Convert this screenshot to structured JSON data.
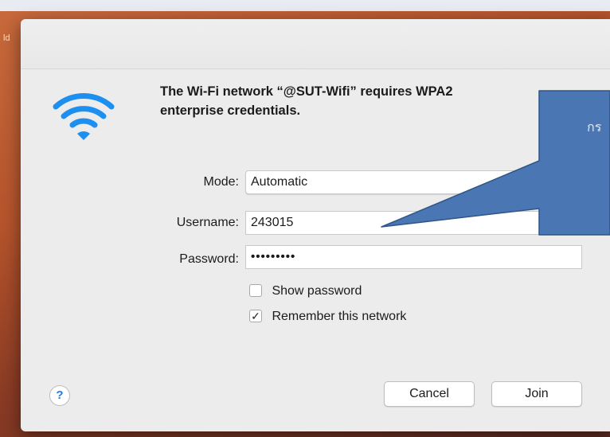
{
  "desktop": {
    "edge_label": "ld"
  },
  "dialog": {
    "message_line1": "The Wi-Fi network “@SUT-Wifi” requires WPA2",
    "message_line2": "enterprise credentials.",
    "mode": {
      "label": "Mode:",
      "value": "Automatic"
    },
    "username": {
      "label": "Username:",
      "value": "243015"
    },
    "password": {
      "label": "Password:",
      "value": "•••••••••"
    },
    "show_password": {
      "label": "Show password",
      "checked": false
    },
    "remember_network": {
      "label": "Remember this network",
      "checked": true,
      "check_glyph": "✓"
    },
    "help_label": "?",
    "cancel_label": "Cancel",
    "join_label": "Join"
  },
  "callout": {
    "text": "กร"
  },
  "colors": {
    "callout_fill": "#4a77b4",
    "callout_border": "#2f5587",
    "wifi_blue": "#1d8ff0"
  },
  "icons": {
    "wifi": "wifi-icon",
    "help": "question-icon",
    "check": "checkmark-icon"
  }
}
